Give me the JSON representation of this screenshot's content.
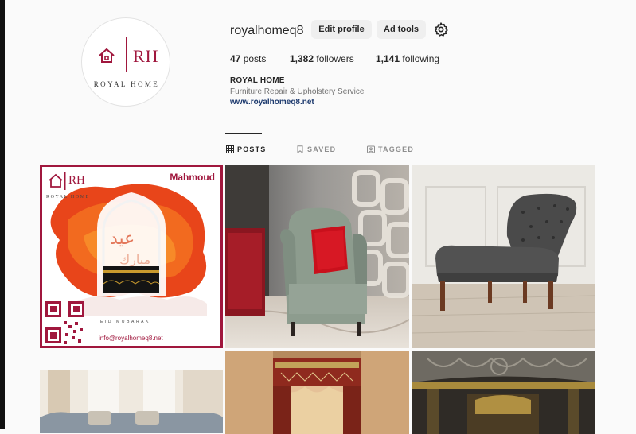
{
  "profile": {
    "username": "royalhomeq8",
    "avatar_initials": "RH",
    "avatar_brand": "ROYAL HOME",
    "buttons": {
      "edit_profile": "Edit profile",
      "ad_tools": "Ad tools"
    },
    "stats": {
      "posts_count": "47",
      "posts_label": "posts",
      "followers_count": "1,382",
      "followers_label": "followers",
      "following_count": "1,141",
      "following_label": "following"
    },
    "bio": {
      "name": "ROYAL HOME",
      "description": "Furniture Repair & Upholstery Service",
      "link": "www.royalhomeq8.net"
    }
  },
  "tabs": [
    {
      "label": "POSTS",
      "icon": "grid-icon",
      "active": true
    },
    {
      "label": "SAVED",
      "icon": "bookmark-icon",
      "active": false
    },
    {
      "label": "TAGGED",
      "icon": "tagged-icon",
      "active": false
    }
  ],
  "posts": {
    "first": {
      "brand_initials": "RH",
      "brand_name": "ROYAL HOME",
      "name_tag": "Mahmoud",
      "greeting_arabic": "عيد مبارك",
      "greeting_latin": "EID MUBARAK",
      "email": "info@royalhomeq8.net"
    }
  },
  "colors": {
    "brand": "#a0173d",
    "link": "#1d3a6e",
    "muted": "#737373"
  }
}
